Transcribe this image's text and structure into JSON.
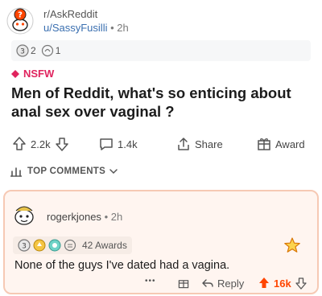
{
  "post": {
    "subreddit": "r/AskReddit",
    "author": "u/SassyFusilli",
    "separator": "•",
    "age": "2h",
    "awards": [
      {
        "icon": "silver-award-icon",
        "count": "2"
      },
      {
        "icon": "helpful-award-icon",
        "count": "1"
      }
    ],
    "nsfw_label": "NSFW",
    "title": "Men of Reddit, what's so enticing about anal sex over vaginal ?"
  },
  "actions": {
    "upvotes": "2.2k",
    "comments": "1.4k",
    "share": "Share",
    "award": "Award"
  },
  "sort": {
    "label": "TOP COMMENTS"
  },
  "comment": {
    "username": "rogerkjones",
    "separator": "•",
    "age": "2h",
    "awards_count": "42 Awards",
    "body": "None of the guys I've dated had a vagina.",
    "more": "•••",
    "reply": "Reply",
    "score": "16k"
  },
  "colors": {
    "nsfw": "#e0245e",
    "upvote_active": "#ff4500",
    "comment_bg": "#fff5f0",
    "comment_border": "#f6c9b4",
    "author_link": "#3a6fb0"
  }
}
